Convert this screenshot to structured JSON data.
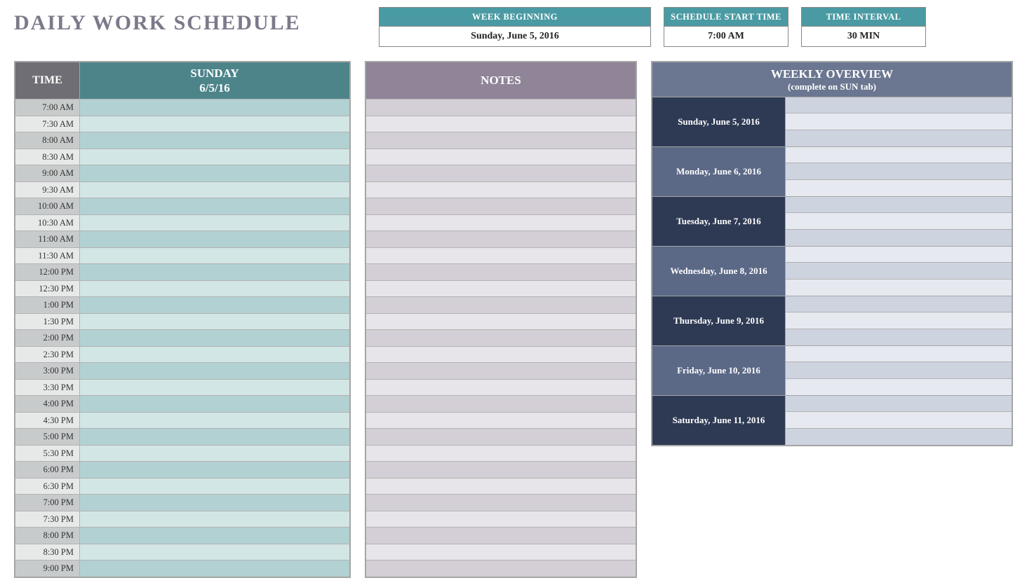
{
  "title": "DAILY WORK SCHEDULE",
  "info": {
    "week_label": "WEEK BEGINNING",
    "week_value": "Sunday, June 5, 2016",
    "start_label": "SCHEDULE START TIME",
    "start_value": "7:00 AM",
    "interval_label": "TIME INTERVAL",
    "interval_value": "30 MIN"
  },
  "schedule": {
    "time_header": "TIME",
    "day_name": "SUNDAY",
    "day_date": "6/5/16",
    "rows": [
      {
        "time": "7:00 AM",
        "task": ""
      },
      {
        "time": "7:30 AM",
        "task": ""
      },
      {
        "time": "8:00 AM",
        "task": ""
      },
      {
        "time": "8:30 AM",
        "task": ""
      },
      {
        "time": "9:00 AM",
        "task": ""
      },
      {
        "time": "9:30 AM",
        "task": ""
      },
      {
        "time": "10:00 AM",
        "task": ""
      },
      {
        "time": "10:30 AM",
        "task": ""
      },
      {
        "time": "11:00 AM",
        "task": ""
      },
      {
        "time": "11:30 AM",
        "task": ""
      },
      {
        "time": "12:00 PM",
        "task": ""
      },
      {
        "time": "12:30 PM",
        "task": ""
      },
      {
        "time": "1:00 PM",
        "task": ""
      },
      {
        "time": "1:30 PM",
        "task": ""
      },
      {
        "time": "2:00 PM",
        "task": ""
      },
      {
        "time": "2:30 PM",
        "task": ""
      },
      {
        "time": "3:00 PM",
        "task": ""
      },
      {
        "time": "3:30 PM",
        "task": ""
      },
      {
        "time": "4:00 PM",
        "task": ""
      },
      {
        "time": "4:30 PM",
        "task": ""
      },
      {
        "time": "5:00 PM",
        "task": ""
      },
      {
        "time": "5:30 PM",
        "task": ""
      },
      {
        "time": "6:00 PM",
        "task": ""
      },
      {
        "time": "6:30 PM",
        "task": ""
      },
      {
        "time": "7:00 PM",
        "task": ""
      },
      {
        "time": "7:30 PM",
        "task": ""
      },
      {
        "time": "8:00 PM",
        "task": ""
      },
      {
        "time": "8:30 PM",
        "task": ""
      },
      {
        "time": "9:00 PM",
        "task": ""
      }
    ]
  },
  "notes": {
    "header": "NOTES",
    "count": 29
  },
  "overview": {
    "title": "WEEKLY OVERVIEW",
    "subtitle": "(complete on SUN tab)",
    "days": [
      "Sunday, June 5, 2016",
      "Monday, June 6, 2016",
      "Tuesday, June 7, 2016",
      "Wednesday, June 8, 2016",
      "Thursday, June 9, 2016",
      "Friday, June 10, 2016",
      "Saturday, June 11, 2016"
    ]
  }
}
